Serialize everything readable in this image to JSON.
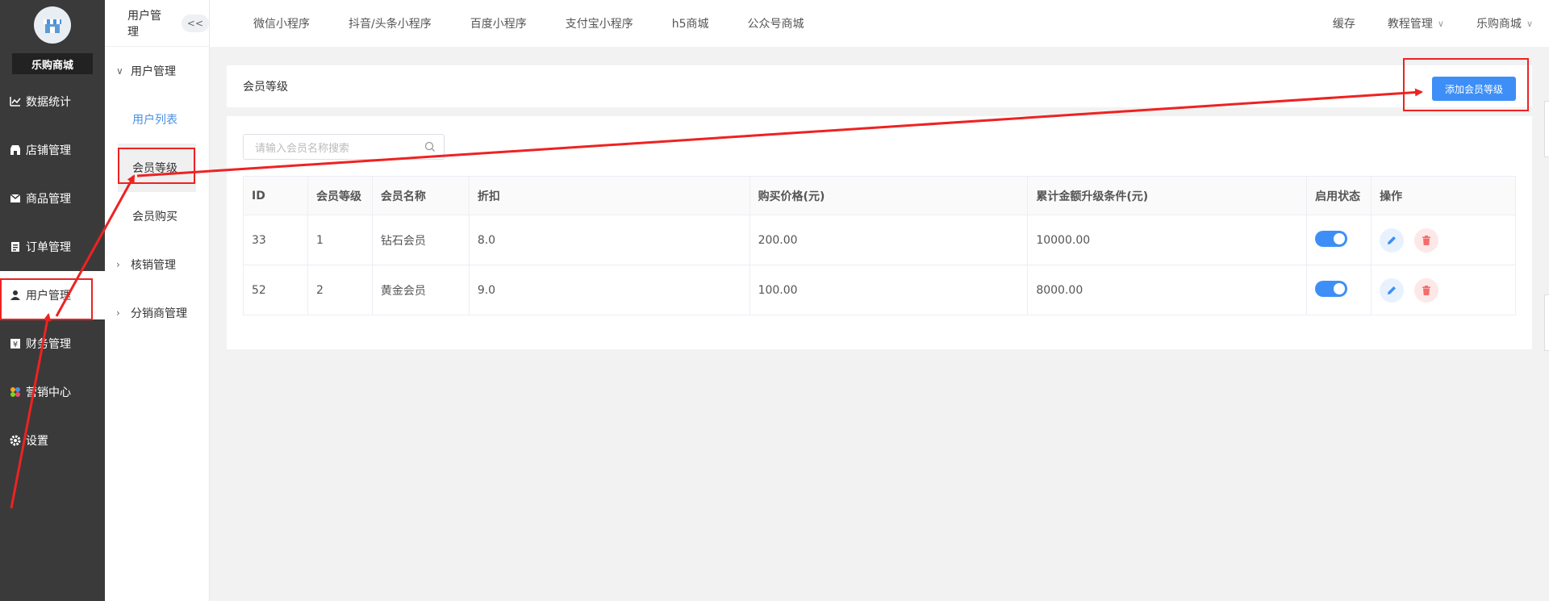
{
  "sidebar": {
    "store_name": "乐购商城",
    "items": [
      {
        "label": "数据统计",
        "icon": "chart-line-icon"
      },
      {
        "label": "店铺管理",
        "icon": "shop-icon"
      },
      {
        "label": "商品管理",
        "icon": "box-icon"
      },
      {
        "label": "订单管理",
        "icon": "order-icon"
      },
      {
        "label": "用户管理",
        "icon": "user-icon"
      },
      {
        "label": "财务管理",
        "icon": "finance-icon"
      },
      {
        "label": "营销中心",
        "icon": "marketing-icon"
      },
      {
        "label": "设置",
        "icon": "gear-icon"
      }
    ]
  },
  "subnav": {
    "title": "用户管理",
    "collapse_label": "<<",
    "group_user": "用户管理",
    "item_user_list": "用户列表",
    "item_member_level": "会员等级",
    "item_member_buy": "会员购买",
    "group_verify": "核销管理",
    "group_distributor": "分销商管理"
  },
  "topbar": {
    "tabs": [
      "微信小程序",
      "抖音/头条小程序",
      "百度小程序",
      "支付宝小程序",
      "h5商城",
      "公众号商城"
    ],
    "cache": "缓存",
    "tutorial": "教程管理",
    "store": "乐购商城"
  },
  "page": {
    "title": "会员等级",
    "add_button": "添加会员等级",
    "search_placeholder": "请输入会员名称搜索"
  },
  "table": {
    "headers": [
      "ID",
      "会员等级",
      "会员名称",
      "折扣",
      "购买价格(元)",
      "累计金额升级条件(元)",
      "启用状态",
      "操作"
    ],
    "rows": [
      {
        "id": "33",
        "level": "1",
        "name": "钻石会员",
        "discount": "8.0",
        "price": "200.00",
        "condition": "10000.00",
        "enabled": true
      },
      {
        "id": "52",
        "level": "2",
        "name": "黄金会员",
        "discount": "9.0",
        "price": "100.00",
        "condition": "8000.00",
        "enabled": true
      }
    ]
  },
  "colors": {
    "accent": "#3d8ff7",
    "annotation": "#ee2222",
    "sidebar_bg": "#3a3a3a"
  }
}
